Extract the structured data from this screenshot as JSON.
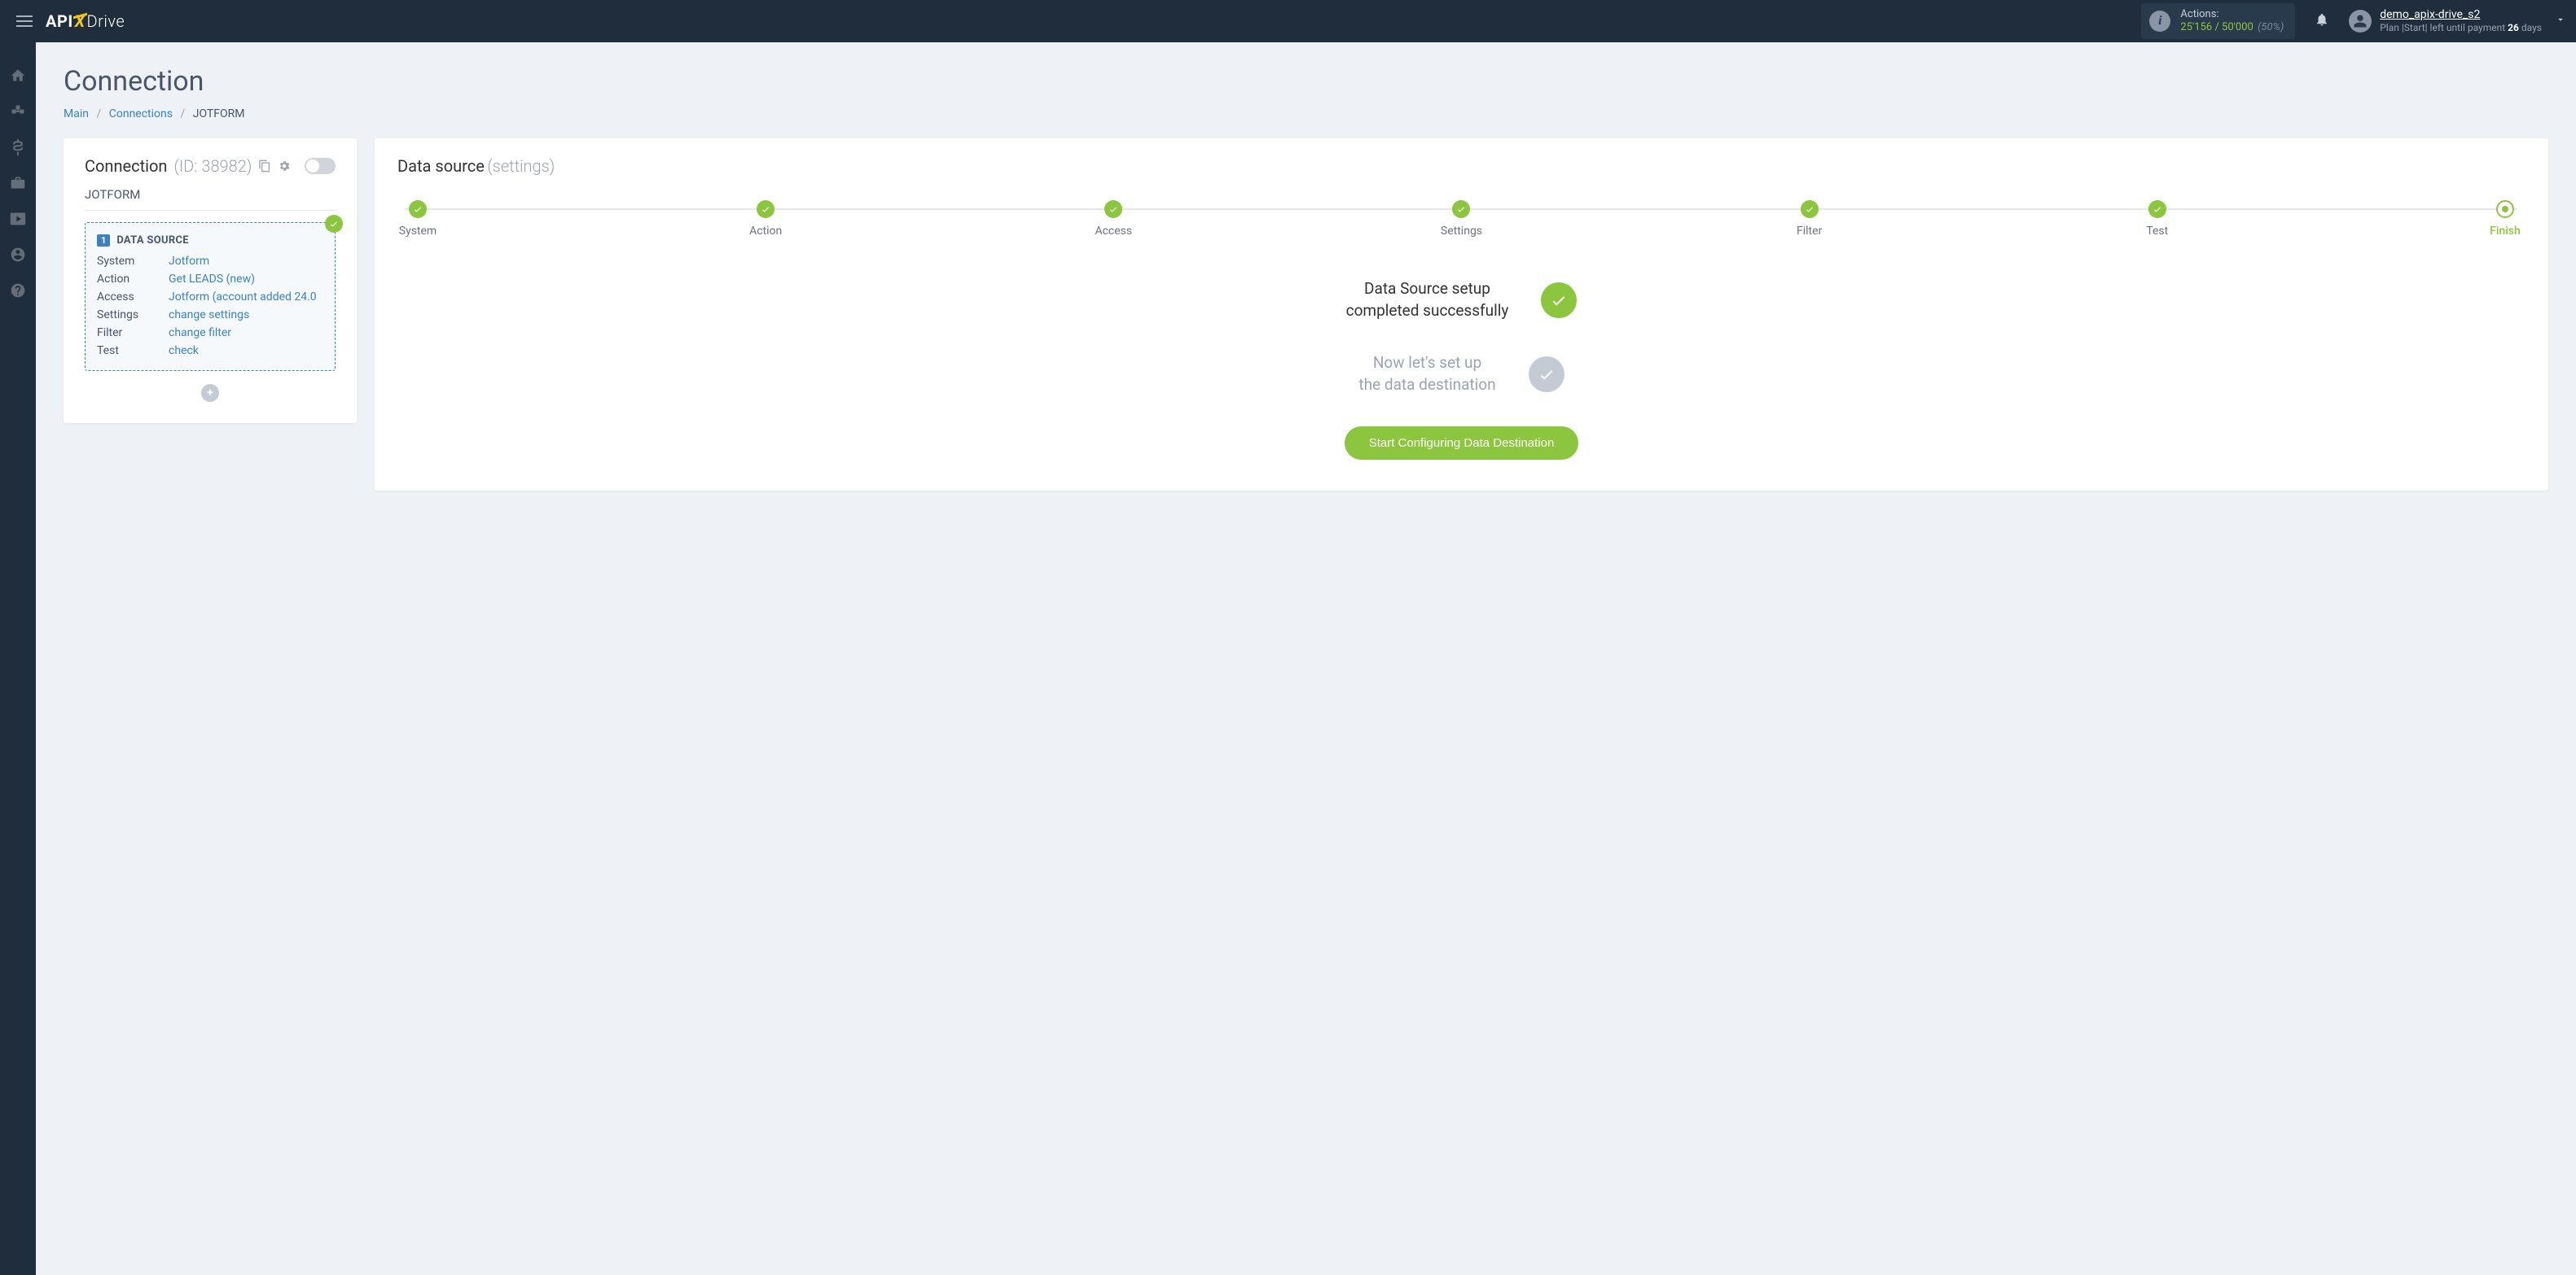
{
  "header": {
    "logo_parts": {
      "api": "API",
      "x": "X",
      "drive": "Drive"
    },
    "actions": {
      "label": "Actions:",
      "used": "25'156",
      "limit": "/ 50'000",
      "pct": "(50%)"
    },
    "user": {
      "name": "demo_apix-drive_s2",
      "plan_prefix": "Plan |Start|  left until payment ",
      "days": "26",
      "days_suffix": " days"
    }
  },
  "page": {
    "title": "Connection",
    "breadcrumb": {
      "main": "Main",
      "connections": "Connections",
      "current": "JOTFORM"
    }
  },
  "left_panel": {
    "title": "Connection",
    "id_label": "(ID: 38982)",
    "conn_name": "JOTFORM",
    "ds": {
      "number": "1",
      "heading": "DATA SOURCE",
      "rows": [
        {
          "label": "System",
          "value": "Jotform"
        },
        {
          "label": "Action",
          "value": "Get LEADS (new)"
        },
        {
          "label": "Access",
          "value": "Jotform (account added 24.0"
        },
        {
          "label": "Settings",
          "value": "change settings"
        },
        {
          "label": "Filter",
          "value": "change filter"
        },
        {
          "label": "Test",
          "value": "check"
        }
      ]
    }
  },
  "right_panel": {
    "title": "Data source",
    "subtitle": "(settings)",
    "steps": [
      "System",
      "Action",
      "Access",
      "Settings",
      "Filter",
      "Test",
      "Finish"
    ],
    "status1": "Data Source setup completed successfully",
    "status2": "Now let's set up the data destination",
    "cta": "Start Configuring Data Destination"
  }
}
